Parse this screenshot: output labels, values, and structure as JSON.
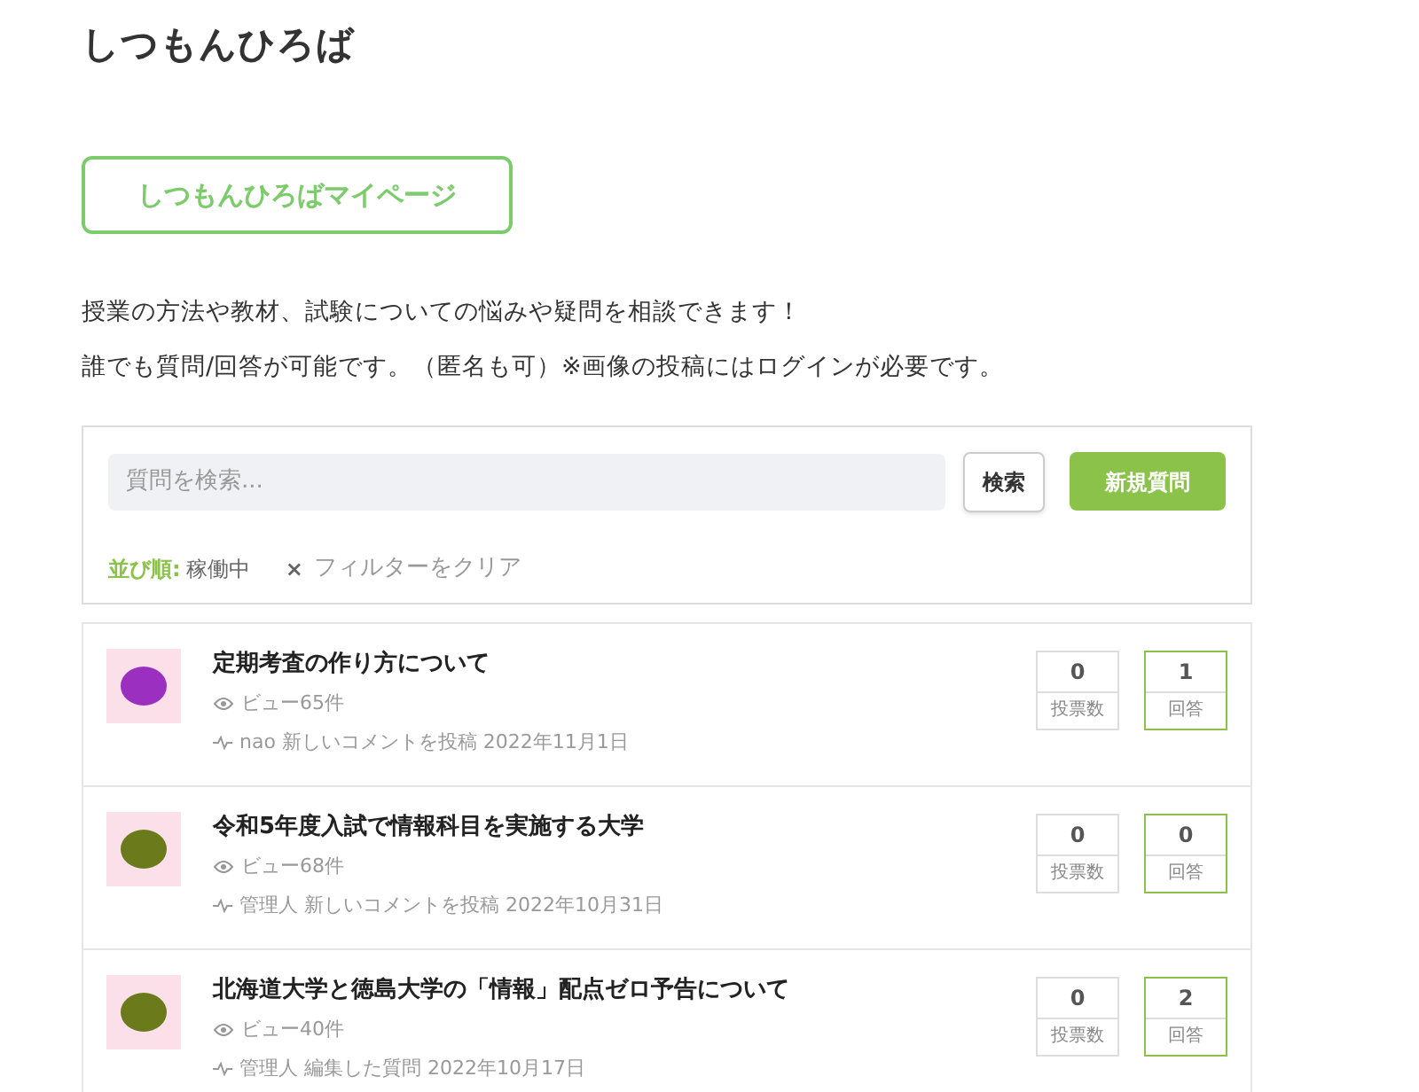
{
  "site_title": "しつもんひろば",
  "mypage_button": "しつもんひろばマイページ",
  "intro": [
    "授業の方法や教材、試験についての悩みや疑問を相談できます！",
    "誰でも質問/回答が可能です。（匿名も可）※画像の投稿にはログインが必要です。"
  ],
  "search": {
    "placeholder": "質問を検索...",
    "search_button": "検索",
    "new_button": "新規質問"
  },
  "sort": {
    "label": "並び順:",
    "value": "稼働中",
    "clear_icon": "×",
    "clear": "フィルターをクリア"
  },
  "questions": [
    {
      "title": "定期考査の作り方について",
      "views": "ビュー65件",
      "activity": "nao 新しいコメントを投稿 2022年11月1日",
      "votes": "0",
      "votes_label": "投票数",
      "answers": "1",
      "answers_label": "回答",
      "color": "#9b30c0"
    },
    {
      "title": "令和5年度入試で情報科目を実施する大学",
      "views": "ビュー68件",
      "activity": "管理人 新しいコメントを投稿 2022年10月31日",
      "votes": "0",
      "votes_label": "投票数",
      "answers": "0",
      "answers_label": "回答",
      "color": "#6b7a1a"
    },
    {
      "title": "北海道大学と徳島大学の「情報」配点ゼロ予告について",
      "views": "ビュー40件",
      "activity": "管理人 編集した質問 2022年10月17日",
      "votes": "0",
      "votes_label": "投票数",
      "answers": "2",
      "answers_label": "回答",
      "color": "#6b7a1a"
    }
  ]
}
